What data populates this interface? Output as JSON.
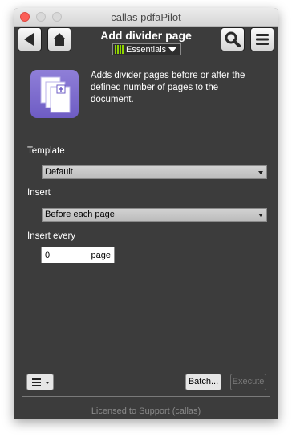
{
  "window": {
    "title": "callas pdfaPilot"
  },
  "toolbar": {
    "panel_title": "Add divider page",
    "profile_filter": "Essentials",
    "back_icon": "back-arrow-icon",
    "home_icon": "home-icon",
    "search_icon": "search-icon",
    "menu_icon": "menu-icon"
  },
  "fixup": {
    "icon": "divider-page-icon",
    "description": "Adds divider pages before or after the defined number of pages to the document."
  },
  "form": {
    "template_label": "Template",
    "template_value": "Default",
    "insert_label": "Insert",
    "insert_value": "Before each page",
    "insert_every_label": "Insert every",
    "insert_every_value": "0",
    "insert_every_unit": "page"
  },
  "actions": {
    "batch_label": "Batch...",
    "execute_label": "Execute"
  },
  "footer": {
    "license_text": "Licensed to Support (callas)"
  },
  "colors": {
    "panel_bg": "#3c3c3c",
    "icon_accent": "#7b6bd0",
    "essentials_bars": "#8fd400",
    "close_button": "#fc5f57"
  }
}
